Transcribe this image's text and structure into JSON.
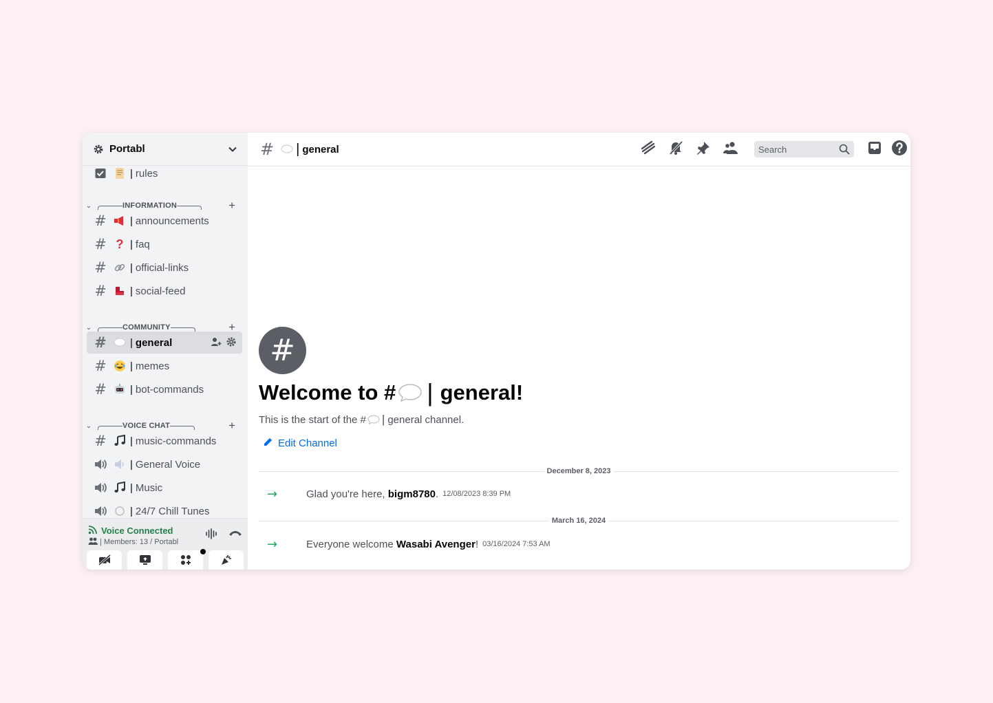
{
  "server": {
    "name": "Portabl"
  },
  "channels": {
    "rules": {
      "name": "rules"
    },
    "information": {
      "label": "INFORMATION",
      "items": [
        {
          "name": "announcements",
          "icon": "megaphone-icon"
        },
        {
          "name": "faq",
          "icon": "question-mark-icon"
        },
        {
          "name": "official-links",
          "icon": "link-icon"
        },
        {
          "name": "social-feed",
          "icon": "social-icon"
        }
      ]
    },
    "community": {
      "label": "COMMUNITY",
      "items": [
        {
          "name": "general",
          "icon": "speech-bubble-icon"
        },
        {
          "name": "memes",
          "icon": "laughing-face-icon"
        },
        {
          "name": "bot-commands",
          "icon": "robot-icon"
        }
      ]
    },
    "voice": {
      "label": "VOICE CHAT",
      "items": [
        {
          "name": "music-commands",
          "icon": "music-notes-icon"
        },
        {
          "name": "General Voice",
          "icon": "speaker-icon"
        },
        {
          "name": "Music",
          "icon": "music-notes-icon"
        },
        {
          "name": "24/7 Chill Tunes",
          "icon": "circle-icon"
        }
      ]
    }
  },
  "voice_panel": {
    "status": "Voice Connected",
    "details": "| Members: 13 / Portabl"
  },
  "topbar": {
    "channel": "general",
    "search_placeholder": "Search"
  },
  "welcome": {
    "title_prefix": "Welcome to #",
    "title_channel": "general!",
    "sub_prefix": "This is the start of the #",
    "sub_suffix": "general channel.",
    "edit_label": "Edit Channel"
  },
  "messages": [
    {
      "date": "December 8, 2023",
      "prefix": "Glad you're here, ",
      "user": "bigm8780",
      "suffix": ".",
      "timestamp": "12/08/2023 8:39 PM"
    },
    {
      "date": "March 16, 2024",
      "prefix": "Everyone welcome ",
      "user": "Wasabi Avenger",
      "suffix": "!",
      "timestamp": "03/16/2024 7:53 AM"
    }
  ],
  "colors": {
    "accent_link": "#006ce7",
    "voice_green": "#248046",
    "join_arrow": "#23a55a",
    "page_background": "#fcf0f4"
  }
}
